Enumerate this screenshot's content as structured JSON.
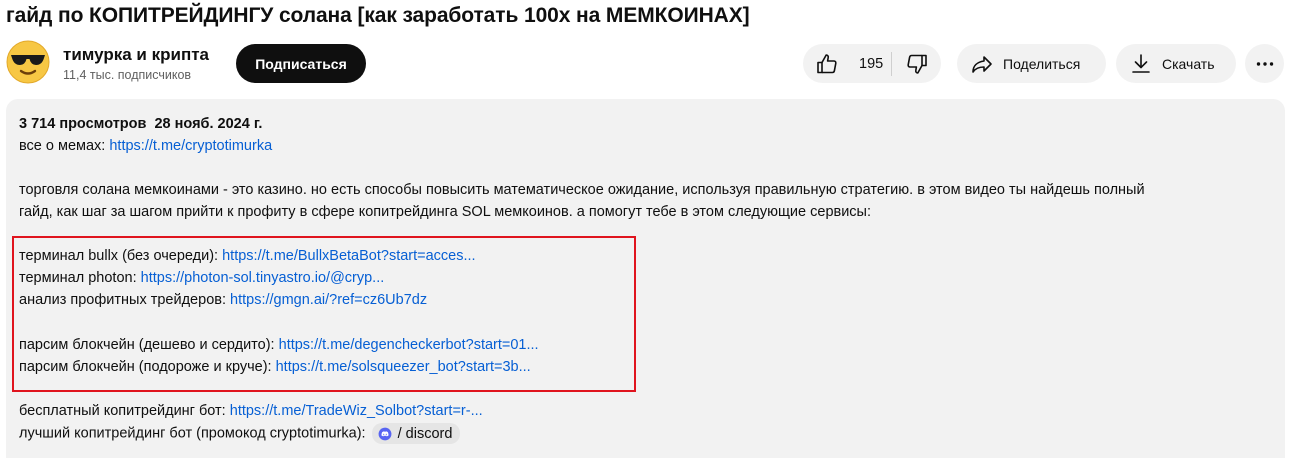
{
  "video": {
    "title": "гайд по КОПИТРЕЙДИНГУ солана [как заработать 100х на МЕМКОИНАХ]"
  },
  "channel": {
    "avatar_icon": "sunglasses-emoji-icon",
    "name": "тимурка и крипта",
    "subscribers": "11,4 тыс. подписчиков",
    "subscribe_label": "Подписаться"
  },
  "actions": {
    "like_count": "195",
    "share_label": "Поделиться",
    "download_label": "Скачать",
    "icons": {
      "like": "thumbs-up-icon",
      "dislike": "thumbs-down-icon",
      "share": "share-arrow-icon",
      "download": "download-icon",
      "more": "more-horizontal-icon"
    }
  },
  "description": {
    "views": "3 714 просмотров",
    "date": "28 нояб. 2024 г.",
    "memes_label": "все о мемах: ",
    "memes_link": "https://t.me/cryptotimurka",
    "paragraph_line1": "торговля солана мемкоинами - это казино. но есть способы повысить математическое ожидание, используя правильную стратегию. в этом видео ты найдешь полный",
    "paragraph_line2": "гайд, как шаг за шагом прийти к профиту в сфере копитрейдинга SOL мемкоинов. а помогут тебе в этом следующие сервисы:",
    "services": [
      {
        "label": "терминал bullx (без очереди): ",
        "link": "https://t.me/BullxBetaBot?start=acces..."
      },
      {
        "label": "терминал photon: ",
        "link": "https://photon-sol.tinyastro.io/@cryp..."
      },
      {
        "label": "анализ профитных трейдеров: ",
        "link": "https://gmgn.ai/?ref=cz6Ub7dz"
      },
      {
        "label": "парсим блокчейн (дешево и сердито): ",
        "link": "https://t.me/degencheckerbot?start=01..."
      },
      {
        "label": "парсим блокчейн (подороже и круче): ",
        "link": "https://t.me/solsqueezer_bot?start=3b..."
      }
    ],
    "free_bot_label": "бесплатный копитрейдинг бот: ",
    "free_bot_link": "https://t.me/TradeWiz_Solbot?start=r-...",
    "best_bot_label": "лучший копитрейдинг бот (промокод cryptotimurka): ",
    "best_bot_chip": "/ discord",
    "chip_icon": "discord-icon"
  },
  "colors": {
    "link": "#065fd4",
    "highlight_border": "#e0141e",
    "panel_bg": "#f2f2f2"
  }
}
